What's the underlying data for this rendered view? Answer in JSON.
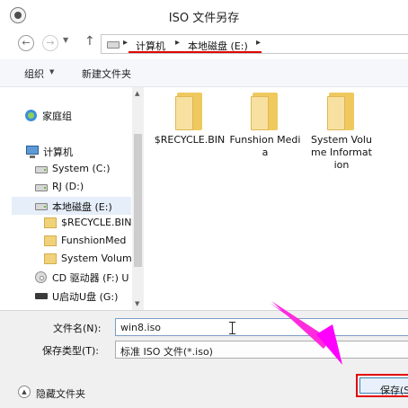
{
  "window": {
    "title": "ISO 文件另存"
  },
  "navigation": {
    "back_icon": "back-arrow-icon",
    "forward_icon": "forward-arrow-icon",
    "up_icon": "up-arrow-icon",
    "breadcrumb": [
      "计算机",
      "本地磁盘 (E:)"
    ],
    "separators": [
      "▸",
      "▸",
      "▸"
    ]
  },
  "toolbar": {
    "organize_label": "组织",
    "new_folder_label": "新建文件夹"
  },
  "sidebar": {
    "items": [
      {
        "label": "家庭组",
        "icon": "homegroup-icon"
      },
      {
        "label": "计算机",
        "icon": "computer-icon"
      },
      {
        "label": "System (C:)",
        "icon": "drive-icon"
      },
      {
        "label": "RJ (D:)",
        "icon": "drive-icon"
      },
      {
        "label": "本地磁盘 (E:)",
        "icon": "drive-icon",
        "selected": true
      },
      {
        "label": "$RECYCLE.BIN",
        "icon": "folder-icon"
      },
      {
        "label": "FunshionMed",
        "icon": "folder-icon"
      },
      {
        "label": "System Volum",
        "icon": "folder-icon"
      },
      {
        "label": "CD 驱动器 (F:) U",
        "icon": "cd-drive-icon"
      },
      {
        "label": "U启动U盘 (G:)",
        "icon": "usb-drive-icon"
      }
    ]
  },
  "content": {
    "files": [
      {
        "name": "$RECYCLE.BIN",
        "icon": "folder-icon"
      },
      {
        "name": "Funshion Media",
        "icon": "folder-icon"
      },
      {
        "name": "System Volume Information",
        "icon": "folder-icon"
      }
    ]
  },
  "form": {
    "filename_label": "文件名(N):",
    "filename_value": "win8.iso",
    "filetype_label": "保存类型(T):",
    "filetype_value": "标准 ISO 文件(*.iso)"
  },
  "footer": {
    "hide_folders_label": "隐藏文件夹",
    "save_label": "保存(S"
  },
  "colors": {
    "highlight_red": "#e00000",
    "annotation_arrow": "#ff00ff",
    "selection_bg": "#e5eef9"
  }
}
